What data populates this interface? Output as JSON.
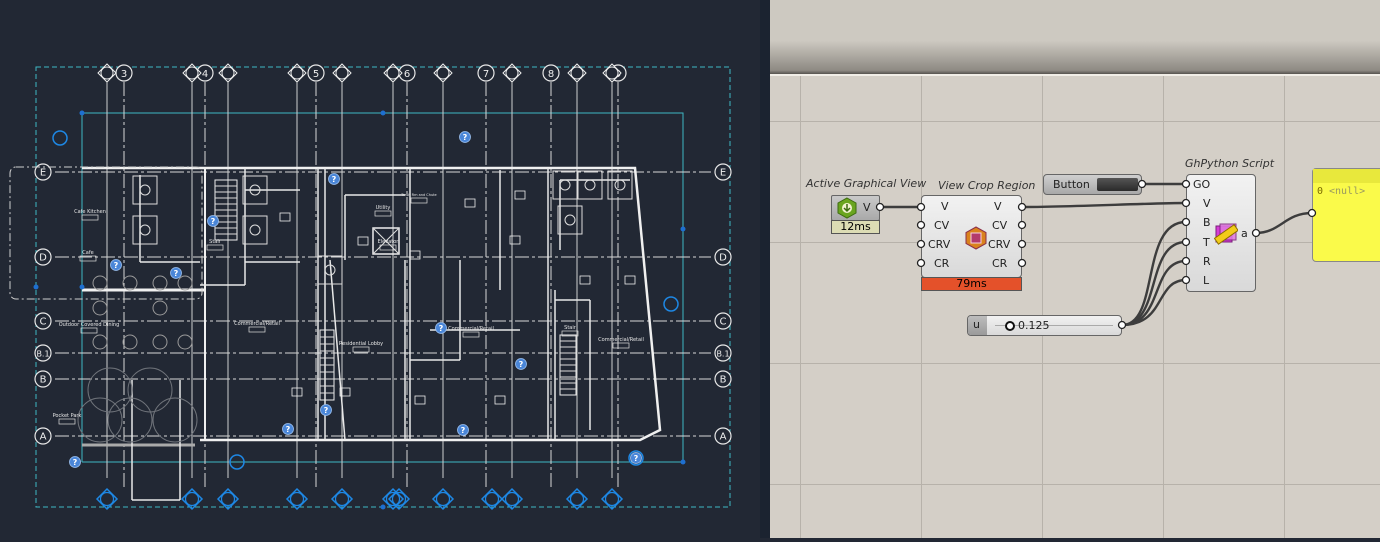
{
  "revit_view": {
    "grid_columns": [
      "3",
      "4",
      "5",
      "6",
      "7",
      "8",
      "9"
    ],
    "grid_rows": [
      "E",
      "D",
      "C",
      "B.1",
      "B",
      "A"
    ],
    "rooms": [
      {
        "name": "Cafe Kitchen"
      },
      {
        "name": "Cafe"
      },
      {
        "name": "Stair"
      },
      {
        "name": "Utility"
      },
      {
        "name": "Elevator"
      },
      {
        "name": "Trash Rm and Chute"
      },
      {
        "name": "Outdoor Covered Dining"
      },
      {
        "name": "Commercial/Retail"
      },
      {
        "name": "Residential Lobby"
      },
      {
        "name": "Commercial/Retail"
      },
      {
        "name": "Stair"
      },
      {
        "name": "Commercial/Retail"
      },
      {
        "name": "Pocket Park"
      }
    ],
    "unknown_marker_glyph": "?",
    "colors": {
      "background": "#222834",
      "lines": "#e6e6e6",
      "crop": "#3fb7c4",
      "markers": "#1e88e5"
    }
  },
  "grasshopper": {
    "components": {
      "active_view": {
        "title": "Active Graphical View",
        "output": "V",
        "timer": "12ms",
        "icon": "active-view-icon"
      },
      "crop_region": {
        "title": "View Crop Region",
        "inputs": [
          "V",
          "CV",
          "CRV",
          "CR"
        ],
        "outputs": [
          "V",
          "CV",
          "CRV",
          "CR"
        ],
        "timer": "79ms",
        "icon": "crop-region-icon"
      },
      "button": {
        "label": "Button"
      },
      "python": {
        "title": "GhPython Script",
        "inputs": [
          "GO",
          "V",
          "B",
          "T",
          "R",
          "L"
        ],
        "output": "a",
        "icon": "python-icon"
      },
      "slider": {
        "name": "u",
        "value": "0.125"
      },
      "panel": {
        "index": "0",
        "value": "<null>"
      }
    },
    "colors": {
      "canvas": "#d4cfc7",
      "timer_slow": "#e4512a",
      "timer_ok": "#dcdcb4",
      "panel": "#fafa4a"
    }
  }
}
